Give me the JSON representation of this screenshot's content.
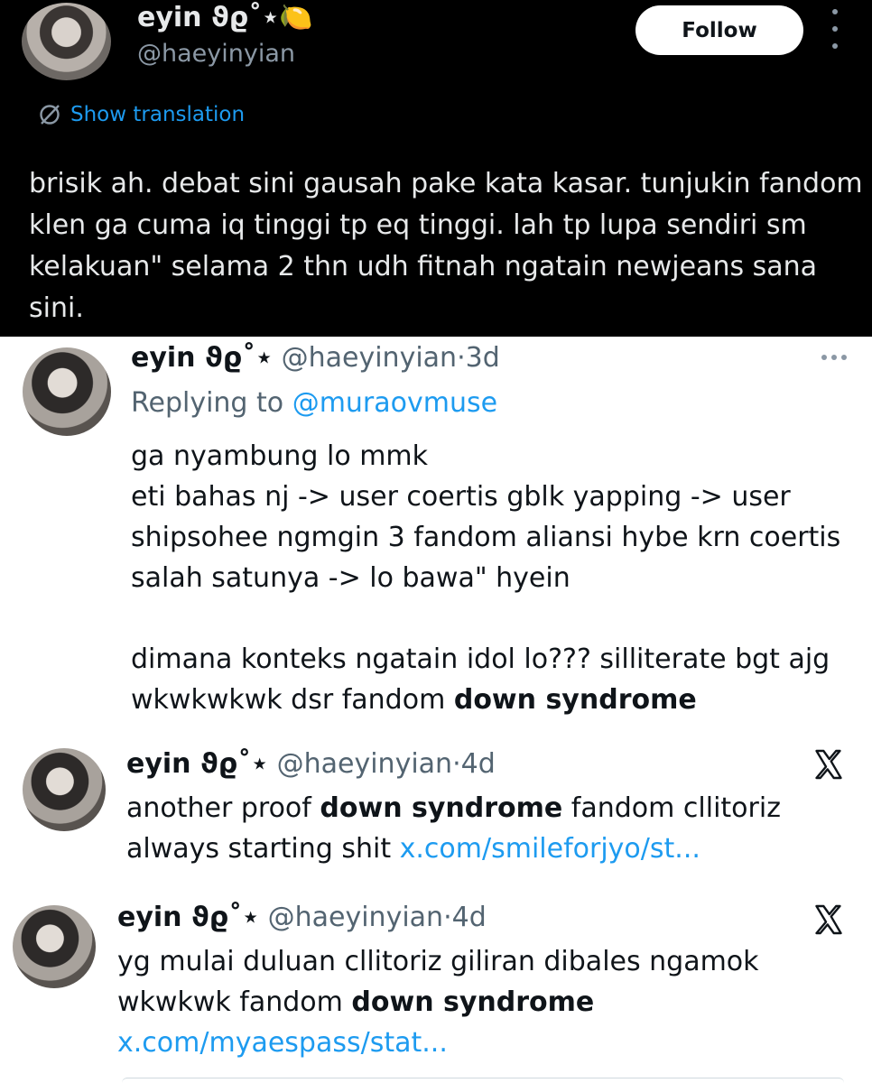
{
  "top_tweet": {
    "display_name": "eyin ϑϱ˚⋆🍋",
    "handle": "@haeyinyian",
    "follow_label": "Follow",
    "translate_icon": "globe-slash-icon",
    "translate_label": "Show translation",
    "body": "brisik ah. debat sini gausah pake kata kasar. tunjukin fandom klen ga cuma iq tinggi tp eq tinggi. lah tp lupa sendiri sm kelakuan\" selama 2 thn udh fitnah ngatain newjeans sana sini."
  },
  "reply_tweet": {
    "display_name": "eyin ϑϱ˚⋆",
    "handle": "@haeyinyian",
    "time": "3d",
    "replying_prefix": "Replying to",
    "replying_to": "@muraovmuse",
    "line1": "ga nyambung lo mmk",
    "line2": "eti bahas nj -> user coertis gblk yapping -> user shipsohee ngmgin 3 fandom aliansi hybe krn coertis salah satunya -> lo bawa\" hyein",
    "line3_start": "dimana konteks ngatain idol lo??? silliterate bgt ajg wkwkwkwk dsr fandom ",
    "line3_bold": "down syndrome"
  },
  "quoted_tweets": [
    {
      "display_name": "eyin ϑϱ˚⋆",
      "handle": "@haeyinyian",
      "time": "4d",
      "text_start": "another proof ",
      "text_bold": "down syndrome",
      "text_end": " fandom cllitoriz always starting shit ",
      "link": "x.com/smileforjyo/st..."
    },
    {
      "display_name": "eyin ϑϱ˚⋆",
      "handle": "@haeyinyian",
      "time": "4d",
      "text_start": "yg mulai duluan cllitoriz giliran dibales ngamok wkwkwk fandom ",
      "text_bold": "down syndrome",
      "text_end": " ",
      "link": "x.com/myaespass/stat..."
    }
  ],
  "colors": {
    "link": "#1d9bf0",
    "dark_bg": "#000000",
    "muted": "#536471"
  }
}
